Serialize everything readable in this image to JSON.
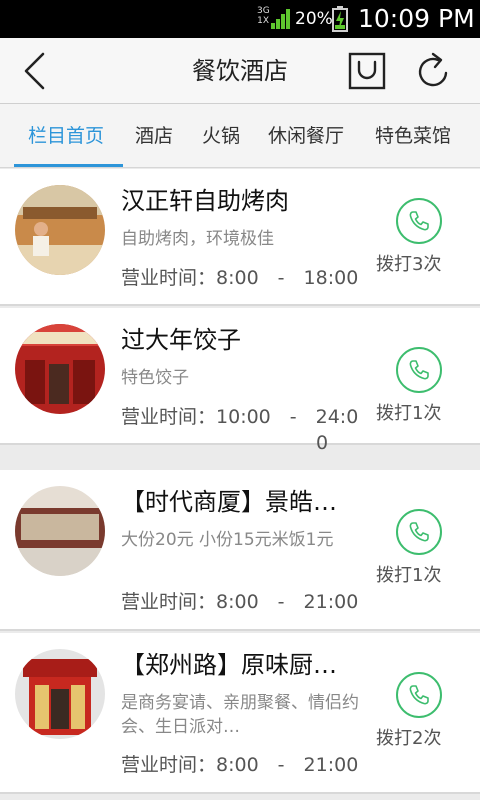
{
  "status_bar": {
    "network_top": "3G",
    "network_bottom": "1X",
    "battery_percent": "20%",
    "time": "10:09 PM"
  },
  "header": {
    "title": "餐饮酒店",
    "back_icon": "back-chevron-icon",
    "bag_icon": "shopping-bag-icon",
    "refresh_icon": "refresh-icon"
  },
  "tabs": [
    {
      "label": "栏目首页",
      "active": true
    },
    {
      "label": "酒店",
      "active": false
    },
    {
      "label": "火锅",
      "active": false
    },
    {
      "label": "休闲餐厅",
      "active": false
    },
    {
      "label": "特色菜馆",
      "active": false
    }
  ],
  "colors": {
    "accent": "#2d95d9",
    "call_green": "#3dbd6e"
  },
  "items": [
    {
      "name": "汉正轩自助烤肉",
      "desc": "自助烤肉，环境极佳",
      "hours_label": "营业时间：",
      "hours_line1": "8:00　-　18:00",
      "hours_line2": "",
      "call_count": "拨打3次"
    },
    {
      "name": "过大年饺子",
      "desc": "特色饺子",
      "hours_label": "营业时间：",
      "hours_line1": "10:00　-　24:0",
      "hours_line2": "0",
      "call_count": "拨打1次"
    },
    {
      "name": "【时代商厦】景皓…",
      "desc": "大份20元 小份15元米饭1元",
      "hours_label": "营业时间：",
      "hours_line1": "8:00　-　21:00",
      "hours_line2": "",
      "call_count": "拨打1次"
    },
    {
      "name": "【郑州路】原味厨…",
      "desc": "是商务宴请、亲朋聚餐、情侣约会、生日派对…",
      "hours_label": "营业时间：",
      "hours_line1": "8:00　-　21:00",
      "hours_line2": "",
      "call_count": "拨打2次"
    }
  ]
}
